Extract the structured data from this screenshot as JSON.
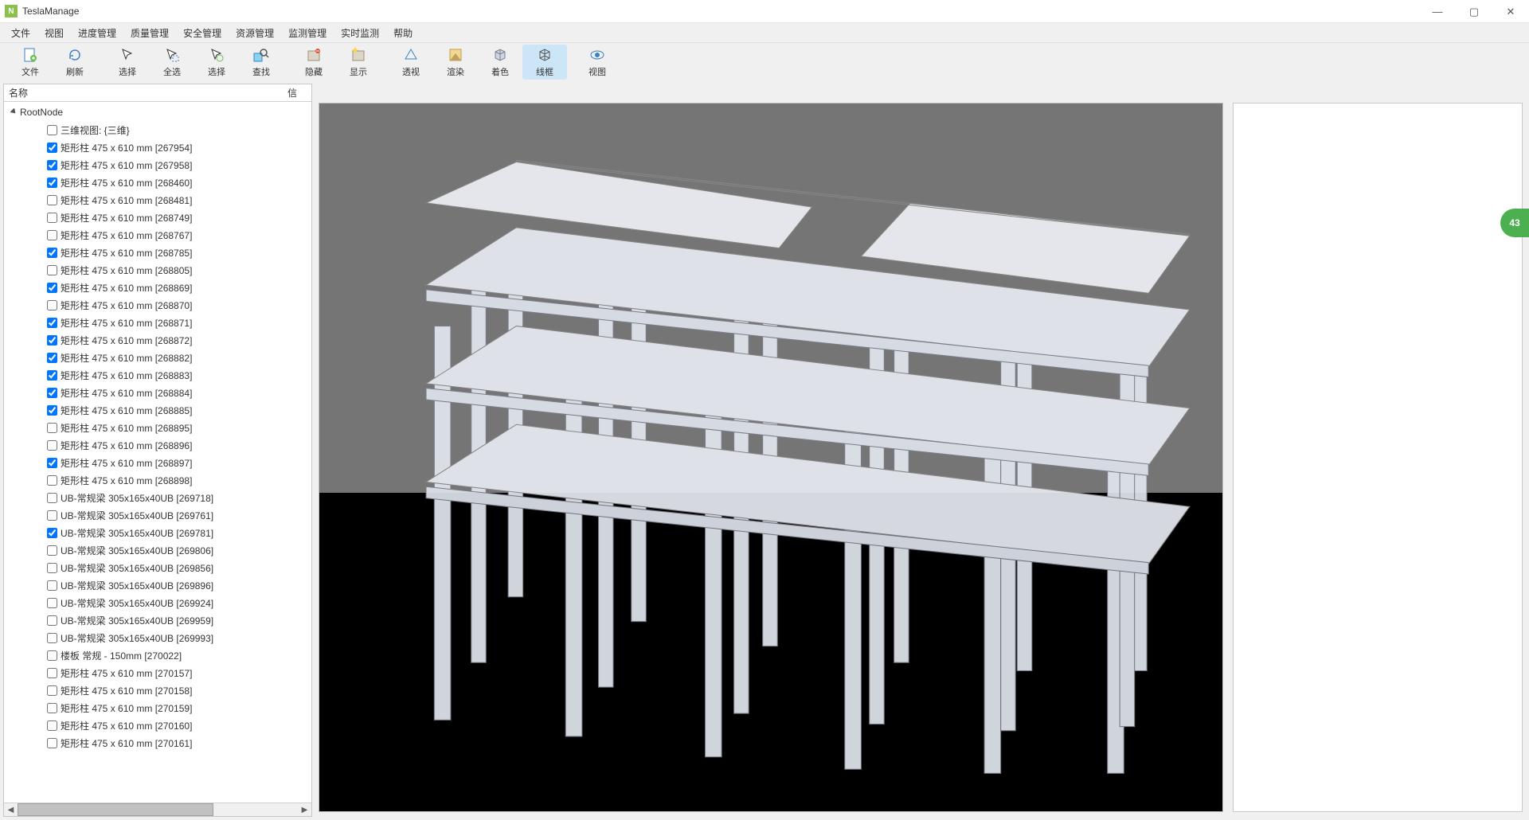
{
  "app": {
    "title": "TeslaManage",
    "icon_letter": "N"
  },
  "window_controls": {
    "min": "—",
    "max": "▢",
    "close": "✕"
  },
  "menu": [
    "文件",
    "视图",
    "进度管理",
    "质量管理",
    "安全管理",
    "资源管理",
    "监测管理",
    "实时监测",
    "帮助"
  ],
  "toolbar": [
    {
      "id": "file",
      "label": "文件",
      "group": 0
    },
    {
      "id": "refresh",
      "label": "刷新",
      "group": 0
    },
    {
      "id": "select",
      "label": "选择",
      "group": 1
    },
    {
      "id": "selectall",
      "label": "全选",
      "group": 1
    },
    {
      "id": "pick",
      "label": "选择",
      "group": 1
    },
    {
      "id": "find",
      "label": "查找",
      "group": 1
    },
    {
      "id": "hide",
      "label": "隐藏",
      "group": 2
    },
    {
      "id": "show",
      "label": "显示",
      "group": 2
    },
    {
      "id": "perspective",
      "label": "透视",
      "group": 3
    },
    {
      "id": "render",
      "label": "渲染",
      "group": 3
    },
    {
      "id": "shade",
      "label": "着色",
      "group": 3
    },
    {
      "id": "wireframe",
      "label": "线框",
      "group": 3,
      "active": true
    },
    {
      "id": "view",
      "label": "视图",
      "group": 4
    }
  ],
  "tree": {
    "header_name": "名称",
    "header_info": "信",
    "root_label": "RootNode",
    "items": [
      {
        "label": "三维视图: {三维}",
        "checked": false
      },
      {
        "label": "矩形柱 475 x 610 mm [267954]",
        "checked": true
      },
      {
        "label": "矩形柱 475 x 610 mm [267958]",
        "checked": true
      },
      {
        "label": "矩形柱 475 x 610 mm [268460]",
        "checked": true
      },
      {
        "label": "矩形柱 475 x 610 mm [268481]",
        "checked": false
      },
      {
        "label": "矩形柱 475 x 610 mm [268749]",
        "checked": false
      },
      {
        "label": "矩形柱 475 x 610 mm [268767]",
        "checked": false
      },
      {
        "label": "矩形柱 475 x 610 mm [268785]",
        "checked": true
      },
      {
        "label": "矩形柱 475 x 610 mm [268805]",
        "checked": false
      },
      {
        "label": "矩形柱 475 x 610 mm [268869]",
        "checked": true
      },
      {
        "label": "矩形柱 475 x 610 mm [268870]",
        "checked": false
      },
      {
        "label": "矩形柱 475 x 610 mm [268871]",
        "checked": true
      },
      {
        "label": "矩形柱 475 x 610 mm [268872]",
        "checked": true
      },
      {
        "label": "矩形柱 475 x 610 mm [268882]",
        "checked": true
      },
      {
        "label": "矩形柱 475 x 610 mm [268883]",
        "checked": true
      },
      {
        "label": "矩形柱 475 x 610 mm [268884]",
        "checked": true
      },
      {
        "label": "矩形柱 475 x 610 mm [268885]",
        "checked": true
      },
      {
        "label": "矩形柱 475 x 610 mm [268895]",
        "checked": false
      },
      {
        "label": "矩形柱 475 x 610 mm [268896]",
        "checked": false
      },
      {
        "label": "矩形柱 475 x 610 mm [268897]",
        "checked": true
      },
      {
        "label": "矩形柱 475 x 610 mm [268898]",
        "checked": false
      },
      {
        "label": "UB-常规梁 305x165x40UB [269718]",
        "checked": false
      },
      {
        "label": "UB-常规梁 305x165x40UB [269761]",
        "checked": false
      },
      {
        "label": "UB-常规梁 305x165x40UB [269781]",
        "checked": true
      },
      {
        "label": "UB-常规梁 305x165x40UB [269806]",
        "checked": false
      },
      {
        "label": "UB-常规梁 305x165x40UB [269856]",
        "checked": false
      },
      {
        "label": "UB-常规梁 305x165x40UB [269896]",
        "checked": false
      },
      {
        "label": "UB-常规梁 305x165x40UB [269924]",
        "checked": false
      },
      {
        "label": "UB-常规梁 305x165x40UB [269959]",
        "checked": false
      },
      {
        "label": "UB-常规梁 305x165x40UB [269993]",
        "checked": false
      },
      {
        "label": "楼板 常规 - 150mm [270022]",
        "checked": false
      },
      {
        "label": "矩形柱 475 x 610 mm [270157]",
        "checked": false
      },
      {
        "label": "矩形柱 475 x 610 mm [270158]",
        "checked": false
      },
      {
        "label": "矩形柱 475 x 610 mm [270159]",
        "checked": false
      },
      {
        "label": "矩形柱 475 x 610 mm [270160]",
        "checked": false
      },
      {
        "label": "矩形柱 475 x 610 mm [270161]",
        "checked": false
      }
    ]
  },
  "badge": {
    "value": "43"
  },
  "colors": {
    "app_icon": "#8bbf4e",
    "accent": "#cde6f7",
    "viewport_bg": "#757575",
    "floor": "#000",
    "structure": "#e2e6ee",
    "badge": "#4CAF50"
  }
}
